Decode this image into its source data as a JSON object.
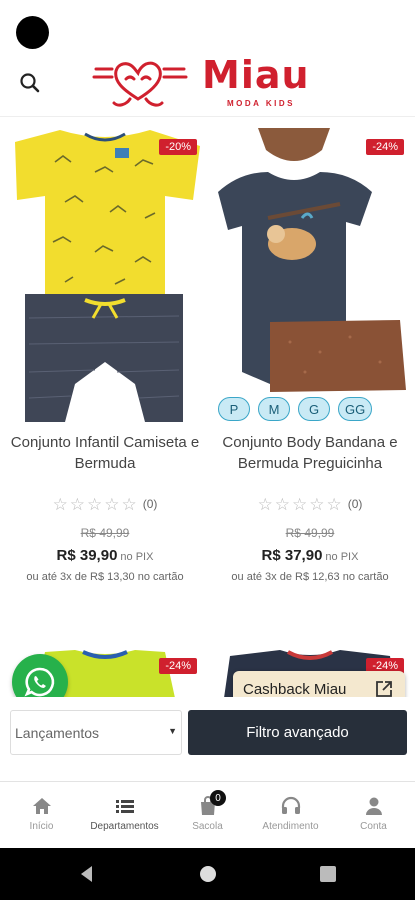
{
  "header": {
    "brand": "Miau",
    "tagline": "MODA KIDS"
  },
  "products": [
    {
      "name": "Conjunto Infantil Camiseta e Bermuda",
      "discount": "-20%",
      "rating_count": "(0)",
      "old_price": "R$ 49,99",
      "price": "R$ 39,90",
      "price_suffix": "no PIX",
      "installments": "ou até 3x de R$ 13,30 no cartão"
    },
    {
      "name": "Conjunto Body Bandana e Bermuda Preguicinha",
      "discount": "-24%",
      "rating_count": "(0)",
      "old_price": "R$ 49,99",
      "price": "R$ 37,90",
      "price_suffix": "no PIX",
      "installments": "ou até 3x de R$ 12,63 no cartão",
      "sizes": [
        "P",
        "M",
        "G",
        "GG"
      ]
    }
  ],
  "next_products": [
    {
      "discount": "-24%"
    },
    {
      "discount": "-24%"
    }
  ],
  "cashback": {
    "label": "Cashback Miau"
  },
  "filters": {
    "sort_value": "Lançamentos",
    "advanced_label": "Filtro avançado"
  },
  "bottom_nav": {
    "items": [
      {
        "label": "Início",
        "icon": "home-icon"
      },
      {
        "label": "Departamentos",
        "icon": "list-icon"
      },
      {
        "label": "Sacola",
        "icon": "bag-icon",
        "badge": "0"
      },
      {
        "label": "Atendimento",
        "icon": "headset-icon"
      },
      {
        "label": "Conta",
        "icon": "user-icon"
      }
    ]
  },
  "colors": {
    "brand_red": "#d0202e",
    "dark_button": "#272f3a",
    "whatsapp_green": "#27b14b",
    "size_chip": "#c9eaf5"
  }
}
